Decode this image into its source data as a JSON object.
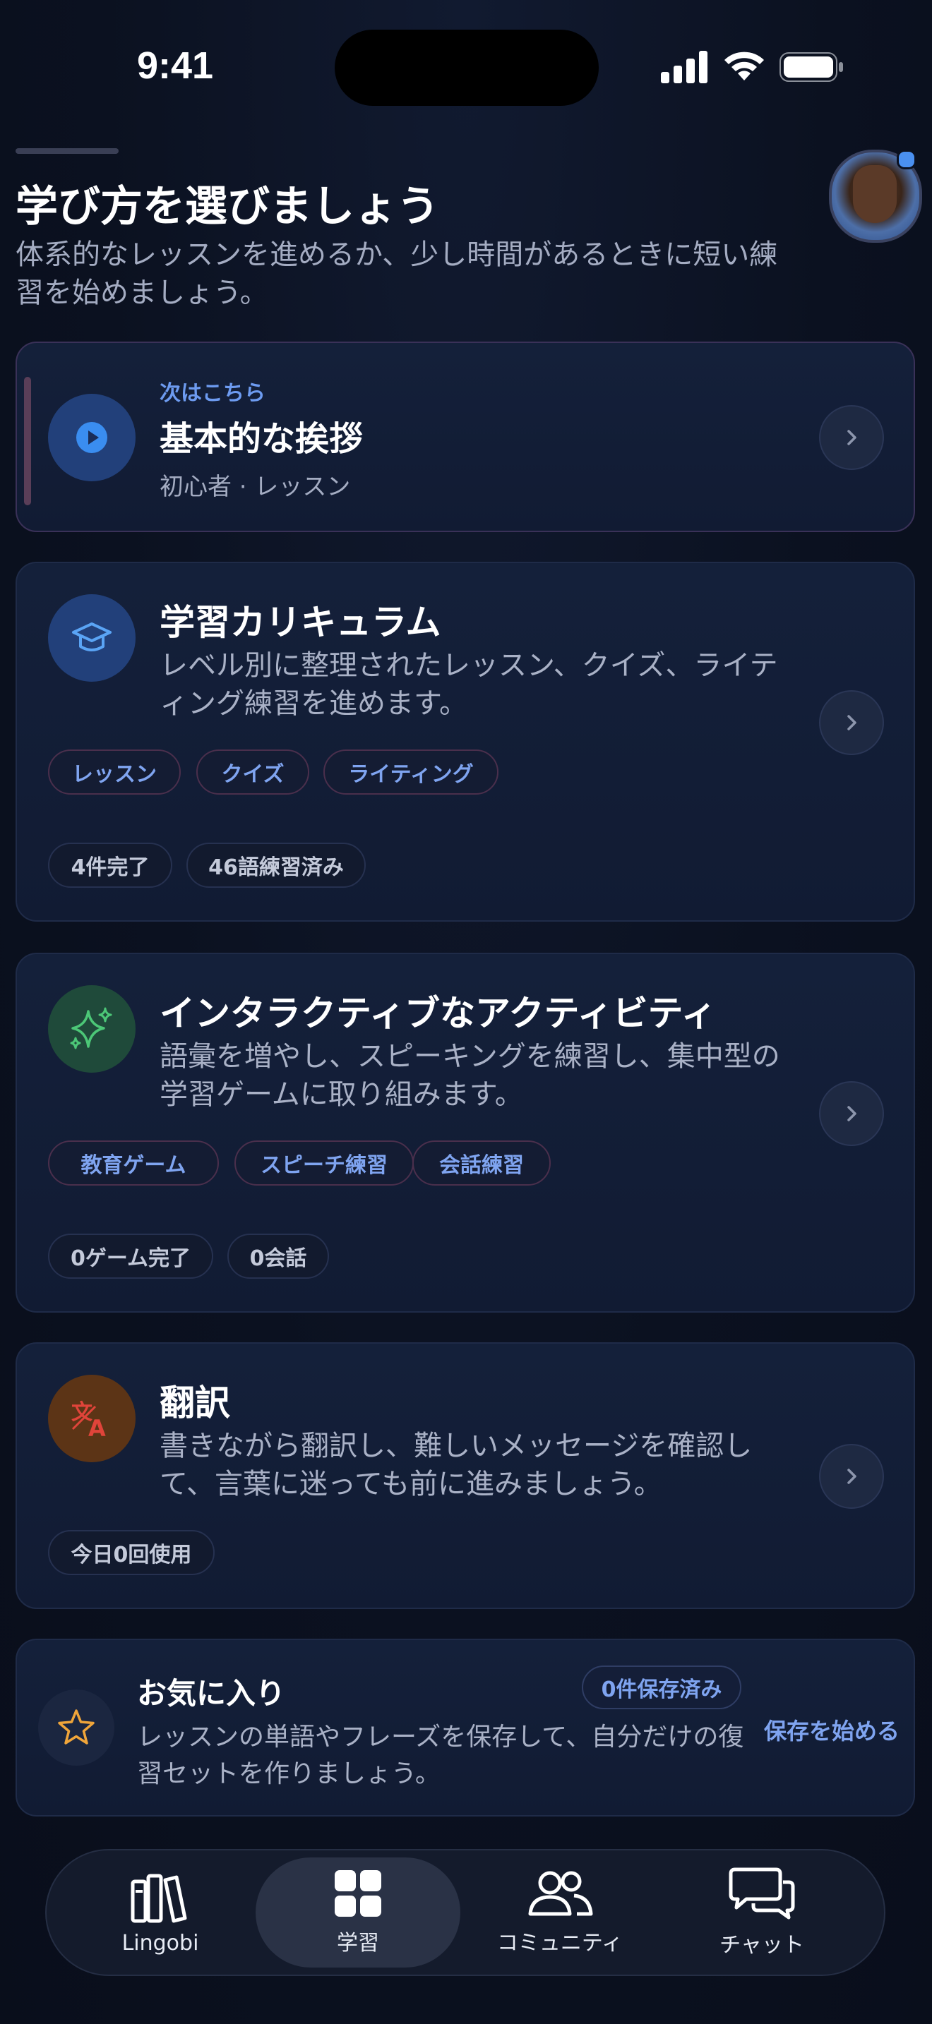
{
  "status_bar": {
    "time": "9:41"
  },
  "header": {
    "title": "学び方を選びましょう",
    "subtitle": "体系的なレッスンを進めるか、少し時間があるときに短い練習を始めましょう。"
  },
  "next_card": {
    "label": "次はこちら",
    "title": "基本的な挨拶",
    "meta": "初心者 · レッスン"
  },
  "curriculum_card": {
    "title": "学習カリキュラム",
    "description": "レベル別に整理されたレッスン、クイズ、ライティング練習を進めます。",
    "tags": [
      "レッスン",
      "クイズ",
      "ライティング"
    ],
    "stats": [
      "4件完了",
      "46語練習済み"
    ]
  },
  "activities_card": {
    "title": "インタラクティブなアクティビティ",
    "description": "語彙を増やし、スピーキングを練習し、集中型の学習ゲームに取り組みます。",
    "tags": [
      "教育ゲーム",
      "スピーチ練習",
      "会話練習"
    ],
    "stats": [
      "0ゲーム完了",
      "0会話"
    ]
  },
  "translation_card": {
    "title": "翻訳",
    "description": "書きながら翻訳し、難しいメッセージを確認して、言葉に迷っても前に進みましょう。",
    "stats": [
      "今日0回使用"
    ]
  },
  "favorites_card": {
    "title": "お気に入り",
    "badge": "0件保存済み",
    "description": "レッスンの単語やフレーズを保存して、自分だけの復習セットを作りましょう。",
    "action": "保存を始める"
  },
  "tab_bar": {
    "tabs": [
      {
        "label": "Lingobi",
        "icon": "books-icon",
        "active": false
      },
      {
        "label": "学習",
        "icon": "grid-icon",
        "active": true
      },
      {
        "label": "コミュニティ",
        "icon": "people-icon",
        "active": false
      },
      {
        "label": "チャット",
        "icon": "chat-bubbles-icon",
        "active": false
      }
    ]
  },
  "colors": {
    "background": "#0b1120",
    "accent_blue": "#7fa4f0",
    "card": "#14203a"
  }
}
